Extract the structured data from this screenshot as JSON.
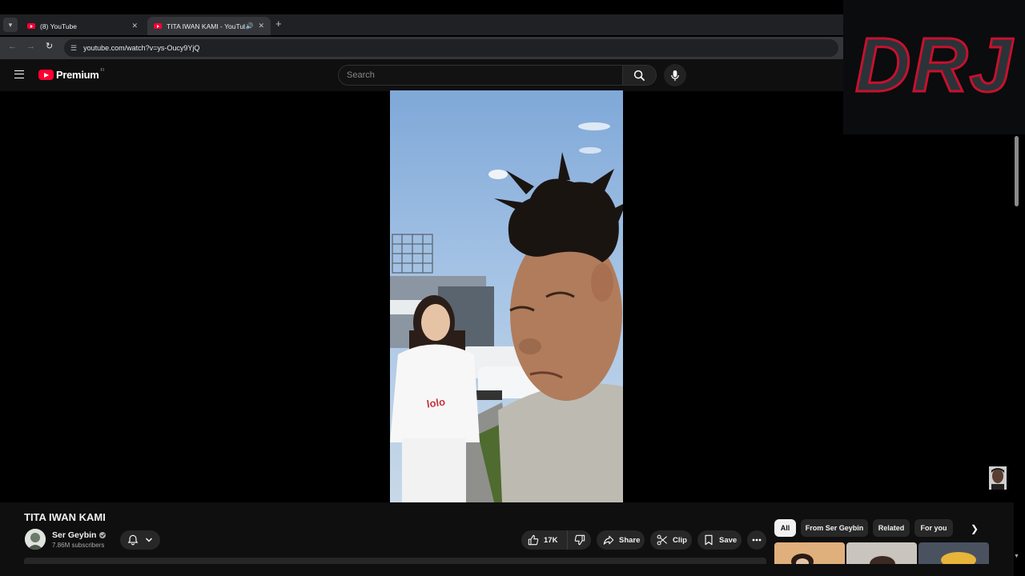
{
  "browser": {
    "tabs": [
      {
        "title": "(8) YouTube",
        "active": false
      },
      {
        "title": "TITA IWAN KAMI - YouTube",
        "active": true
      }
    ],
    "url": "youtube.com/watch?v=ys-Oucy9YjQ"
  },
  "header": {
    "logo_text": "Premium",
    "logo_badge": "FI",
    "search_placeholder": "Search"
  },
  "overlay": {
    "text": "DRJ"
  },
  "video": {
    "title": "TITA IWAN KAMI"
  },
  "channel": {
    "name": "Ser Geybin",
    "subscribers": "7.86M subscribers"
  },
  "actions": {
    "likes": "17K",
    "share": "Share",
    "clip": "Clip",
    "save": "Save"
  },
  "chips": [
    "All",
    "From Ser Geybin",
    "Related",
    "For you"
  ],
  "colors": {
    "page_bg": "#0f0f0f",
    "brand_red": "#ff0033",
    "overlay_red": "#c8102e",
    "chip_bg": "#272727"
  }
}
